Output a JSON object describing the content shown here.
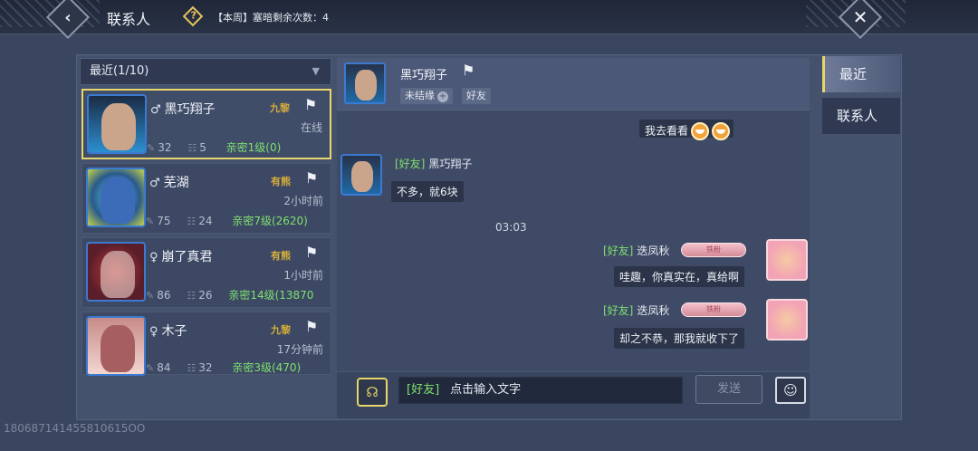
{
  "header": {
    "back_icon": "chevron-left-icon",
    "title": "联系人",
    "help_icon": "diamond-question-icon",
    "help_glyph": "?",
    "weekly_text": "【本周】塞暗剩余次数：4",
    "close_icon": "close-icon"
  },
  "contacts": {
    "filter_label": "最近(1/10)",
    "items": [
      {
        "gender": "♂",
        "name": "黑巧翔子",
        "rank": "九黎",
        "status": "在线",
        "level": "32",
        "power": "5",
        "intimacy": "亲密1级(0)"
      },
      {
        "gender": "♂",
        "name": "芜湖",
        "rank": "有熊",
        "status": "2小时前",
        "level": "75",
        "power": "24",
        "intimacy": "亲密7级(2620)"
      },
      {
        "gender": "♀",
        "name": "崩了真君",
        "rank": "有熊",
        "status": "1小时前",
        "level": "86",
        "power": "26",
        "intimacy": "亲密14级(13870"
      },
      {
        "gender": "♀",
        "name": "木子",
        "rank": "九黎",
        "status": "17分钟前",
        "level": "84",
        "power": "32",
        "intimacy": "亲密3级(470)"
      }
    ]
  },
  "chat": {
    "header_name": "黑巧翔子",
    "tag_unbound": "未结缘",
    "tag_unbound_glyph": "+",
    "tag_friend": "好友",
    "messages": [
      {
        "side": "right",
        "text": "我去看看"
      },
      {
        "side": "left",
        "tag": "[好友]",
        "name": "黑巧翔子",
        "text": "不多，就6块"
      },
      {
        "time": "03:03"
      },
      {
        "side": "right",
        "tag": "[好友]",
        "name": "迭凤秋",
        "badge": "铁粉",
        "text": "哇趣，你真实在，真给啊"
      },
      {
        "side": "right",
        "tag": "[好友]",
        "name": "迭凤秋",
        "badge": "铁粉",
        "text": "却之不恭，那我就收下了"
      }
    ]
  },
  "input": {
    "voice_glyph": "☊",
    "channel": "[好友]",
    "placeholder": "点击输入文字",
    "send_label": "发送",
    "emoji_glyph": "☺"
  },
  "tabs": [
    {
      "label": "最近"
    },
    {
      "label": "联系人"
    }
  ],
  "watermark": "180687141455810615OO",
  "colors": {
    "accent_yellow": "#e8d66a",
    "friend_green": "#7ee06f",
    "rank_gold": "#d5ad3a"
  }
}
